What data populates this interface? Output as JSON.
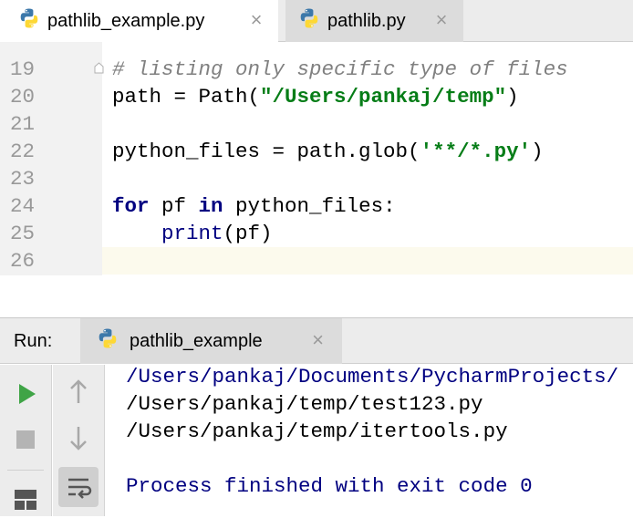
{
  "editor_tabs": [
    {
      "label": "pathlib_example.py",
      "active": true
    },
    {
      "label": "pathlib.py",
      "active": false
    }
  ],
  "code_lines": [
    {
      "num": "19",
      "parts": [
        {
          "t": "# listing only specific type of files",
          "c": "cmt"
        }
      ]
    },
    {
      "num": "20",
      "parts": [
        {
          "t": "path = Path(",
          "c": ""
        },
        {
          "t": "\"/Users/pankaj/temp\"",
          "c": "str"
        },
        {
          "t": ")",
          "c": ""
        }
      ]
    },
    {
      "num": "21",
      "parts": []
    },
    {
      "num": "22",
      "parts": [
        {
          "t": "python_files = path.glob(",
          "c": ""
        },
        {
          "t": "'**/*.py'",
          "c": "str"
        },
        {
          "t": ")",
          "c": ""
        }
      ]
    },
    {
      "num": "23",
      "parts": []
    },
    {
      "num": "24",
      "parts": [
        {
          "t": "for",
          "c": "kw"
        },
        {
          "t": " pf ",
          "c": ""
        },
        {
          "t": "in",
          "c": "kw"
        },
        {
          "t": " python_files:",
          "c": ""
        }
      ]
    },
    {
      "num": "25",
      "parts": [
        {
          "t": "    ",
          "c": ""
        },
        {
          "t": "print",
          "c": "builtin"
        },
        {
          "t": "(pf)",
          "c": ""
        }
      ]
    },
    {
      "num": "26",
      "parts": [],
      "current": true
    }
  ],
  "run_panel": {
    "label": "Run:",
    "tab_label": "pathlib_example"
  },
  "console_lines": [
    {
      "text": "/Users/pankaj/Documents/PycharmProjects/",
      "kind": "path"
    },
    {
      "text": "/Users/pankaj/temp/test123.py",
      "kind": "out"
    },
    {
      "text": "/Users/pankaj/temp/itertools.py",
      "kind": "out"
    },
    {
      "text": "",
      "kind": "out"
    },
    {
      "text": "Process finished with exit code 0",
      "kind": "exit"
    }
  ],
  "tools": {
    "col1": [
      "run-icon",
      "stop-icon",
      "layout-icon"
    ],
    "col2": [
      "up-arrow-icon",
      "down-arrow-icon",
      "soft-wrap-icon"
    ]
  },
  "colors": {
    "keyword": "#000080",
    "string": "#067d17",
    "comment": "#808080",
    "run_green": "#3fa446"
  }
}
